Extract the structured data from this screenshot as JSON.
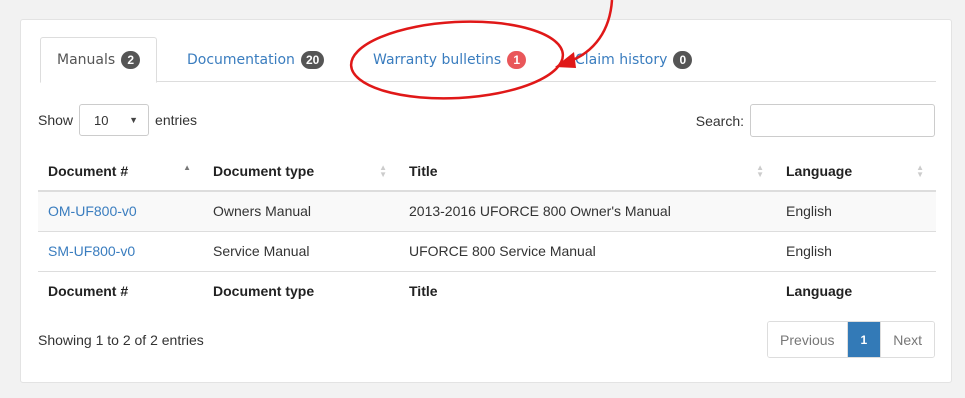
{
  "tabs": [
    {
      "label": "Manuals",
      "badge": "2"
    },
    {
      "label": "Documentation",
      "badge": "20"
    },
    {
      "label": "Warranty bulletins",
      "badge": "1"
    },
    {
      "label": "Claim history",
      "badge": "0"
    }
  ],
  "controls": {
    "show_label": "Show",
    "entries_value": "10",
    "entries_label": "entries",
    "search_label": "Search:"
  },
  "table": {
    "columns": [
      "Document #",
      "Document type",
      "Title",
      "Language"
    ],
    "rows": [
      [
        "OM-UF800-v0",
        "Owners Manual",
        "2013-2016 UFORCE 800 Owner's Manual",
        "English"
      ],
      [
        "SM-UF800-v0",
        "Service Manual",
        "UFORCE 800 Service Manual",
        "English"
      ]
    ]
  },
  "footer": {
    "info": "Showing 1 to 2 of 2 entries",
    "prev_label": "Previous",
    "current_page": "1",
    "next_label": "Next"
  },
  "colors": {
    "link": "#3a7dbf",
    "badge_default": "#555555",
    "badge_alert": "#e9575a",
    "annotation": "#e01818",
    "page_active": "#337ab7"
  }
}
